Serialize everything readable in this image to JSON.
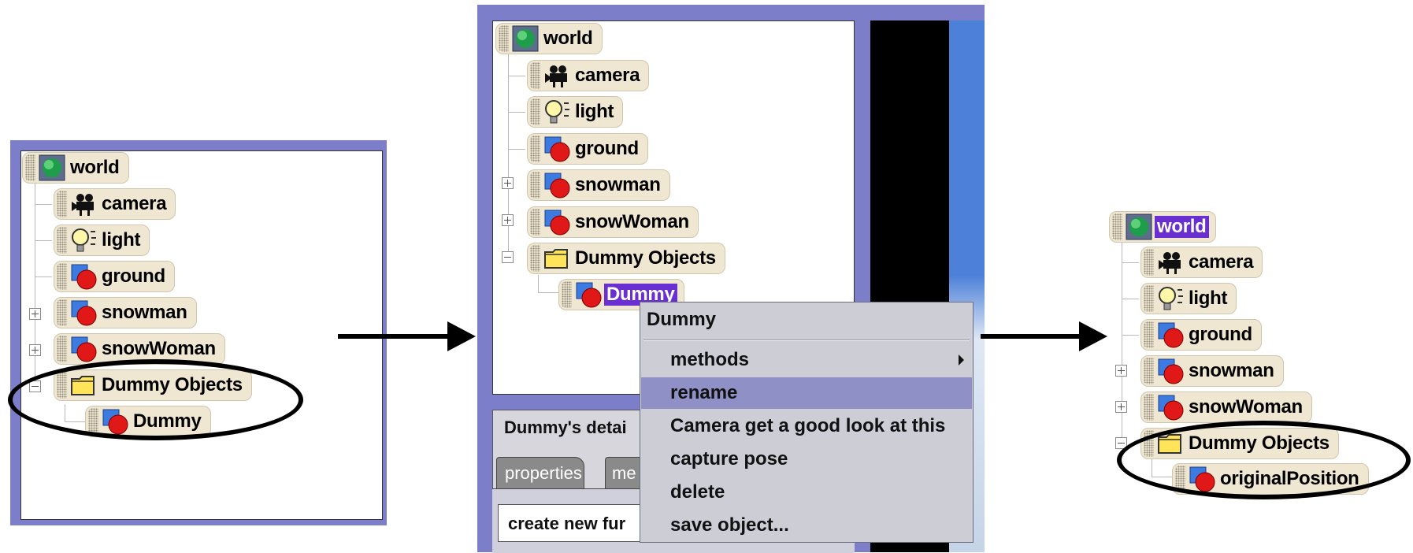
{
  "panel1": {
    "nodes": {
      "world": "world",
      "camera": "camera",
      "light": "light",
      "ground": "ground",
      "snowman": "snowman",
      "snowWoman": "snowWoman",
      "dummy_objects": "Dummy Objects",
      "dummy": "Dummy"
    }
  },
  "panel2": {
    "nodes": {
      "world": "world",
      "camera": "camera",
      "light": "light",
      "ground": "ground",
      "snowman": "snowman",
      "snowWoman": "snowWoman",
      "dummy_objects": "Dummy Objects",
      "dummy": "Dummy"
    },
    "details_title": "Dummy's detai",
    "tabs": [
      "properties",
      "me"
    ],
    "create_button": "create new fur",
    "context_menu": {
      "title": "Dummy",
      "items": [
        "methods",
        "rename",
        "Camera get a good look at this",
        "capture pose",
        "delete",
        "save object..."
      ],
      "highlighted": "rename"
    }
  },
  "panel3": {
    "nodes": {
      "world": "world",
      "camera": "camera",
      "light": "light",
      "ground": "ground",
      "snowman": "snowman",
      "snowWoman": "snowWoman",
      "dummy_objects": "Dummy Objects",
      "dummy": "originalPosition"
    }
  },
  "colors": {
    "panel_border": "#7c7ec9",
    "node_bg": "#efe7d2",
    "selection": "#6a2fd0",
    "menu_bg": "#cdcdd6",
    "menu_highlight": "#8f90c6"
  },
  "icons": {
    "world": "globe-icon",
    "camera": "movie-camera-icon",
    "light": "light-bulb-icon",
    "object": "3d-object-icon",
    "folder": "folder-icon"
  }
}
